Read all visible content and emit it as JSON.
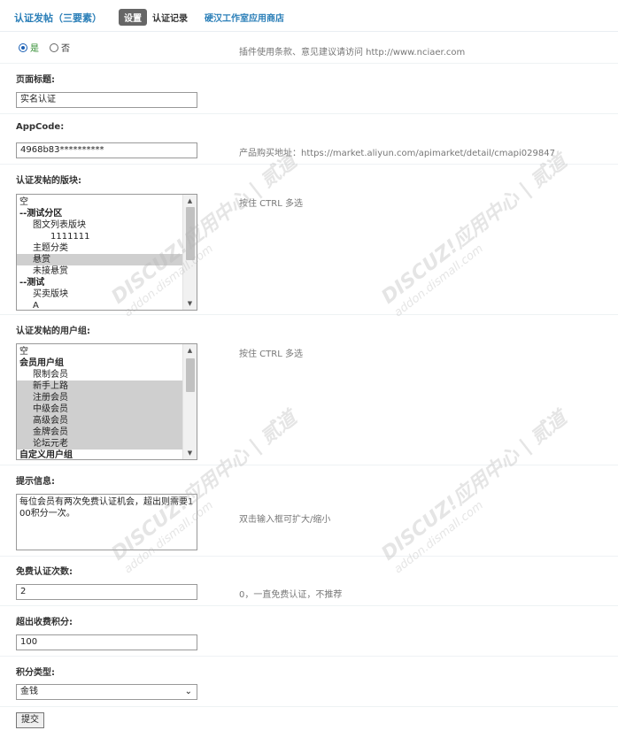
{
  "header": {
    "plugin_title": "认证发帖（三要素）",
    "tabs": [
      {
        "label": "设置",
        "active": true
      },
      {
        "label": "认证记录",
        "active": false
      },
      {
        "label": "硬汉工作室应用商店",
        "active": false
      }
    ]
  },
  "enable": {
    "yes_label": "是",
    "no_label": "否",
    "selected": "是",
    "hint": "插件使用条款、意见建议请访问 http://www.nciaer.com"
  },
  "page_title": {
    "label": "页面标题:",
    "value": "实名认证"
  },
  "appcode": {
    "label": "AppCode:",
    "value": "4968b83**********",
    "hint": "产品购买地址：https://market.aliyun.com/apimarket/detail/cmapi029847"
  },
  "forums": {
    "label": "认证发帖的版块:",
    "hint": "按住 CTRL 多选",
    "options": [
      {
        "text": "空",
        "level": 0,
        "group": false,
        "selected": false
      },
      {
        "text": "--测试分区",
        "level": 0,
        "group": true,
        "selected": false
      },
      {
        "text": "图文列表版块",
        "level": 1,
        "group": false,
        "selected": false
      },
      {
        "text": "1111111",
        "level": 2,
        "group": false,
        "selected": false
      },
      {
        "text": "主题分类",
        "level": 1,
        "group": false,
        "selected": false
      },
      {
        "text": "悬赏",
        "level": 1,
        "group": false,
        "selected": true
      },
      {
        "text": "未接悬赏",
        "level": 1,
        "group": false,
        "selected": false
      },
      {
        "text": "--测试",
        "level": 0,
        "group": true,
        "selected": false
      },
      {
        "text": "买卖版块",
        "level": 1,
        "group": false,
        "selected": false
      },
      {
        "text": "A",
        "level": 1,
        "group": false,
        "selected": false
      }
    ]
  },
  "usergroups": {
    "label": "认证发帖的用户组:",
    "hint": "按住 CTRL 多选",
    "options": [
      {
        "text": "空",
        "level": 0,
        "group": false,
        "selected": false
      },
      {
        "text": "会员用户组",
        "level": 0,
        "group": true,
        "selected": false
      },
      {
        "text": "限制会员",
        "level": 1,
        "group": false,
        "selected": false
      },
      {
        "text": "新手上路",
        "level": 1,
        "group": false,
        "selected": true
      },
      {
        "text": "注册会员",
        "level": 1,
        "group": false,
        "selected": true
      },
      {
        "text": "中级会员",
        "level": 1,
        "group": false,
        "selected": true
      },
      {
        "text": "高级会员",
        "level": 1,
        "group": false,
        "selected": true
      },
      {
        "text": "金牌会员",
        "level": 1,
        "group": false,
        "selected": true
      },
      {
        "text": "论坛元老",
        "level": 1,
        "group": false,
        "selected": true
      },
      {
        "text": "自定义用户组",
        "level": 0,
        "group": true,
        "selected": false
      }
    ]
  },
  "tip": {
    "label": "提示信息:",
    "value": "每位会员有两次免费认证机会，超出则需要100积分一次。",
    "hint": "双击输入框可扩大/缩小"
  },
  "free_count": {
    "label": "免费认证次数:",
    "value": "2",
    "hint": "0，一直免费认证，不推荐"
  },
  "extra_points": {
    "label": "超出收费积分:",
    "value": "100"
  },
  "points_type": {
    "label": "积分类型:",
    "value": "金钱"
  },
  "submit_label": "提交",
  "watermark": {
    "line1": "DISCUZ!应用中心 | 贰道",
    "line2": "addon.dismall.com"
  }
}
